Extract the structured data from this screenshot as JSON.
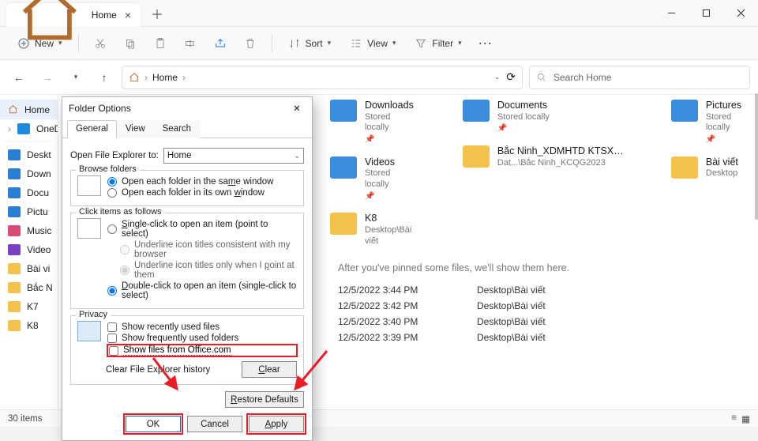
{
  "tab": {
    "title": "Home"
  },
  "toolbar": {
    "new": "New",
    "sort": "Sort",
    "view": "View",
    "filter": "Filter"
  },
  "breadcrumb": {
    "home": "Home"
  },
  "search": {
    "placeholder": "Search Home"
  },
  "sidebar": {
    "items": [
      "Home",
      "OneD",
      "Deskt",
      "Down",
      "Docu",
      "Pictu",
      "Music",
      "Video",
      "Bài vi",
      "Bắc N",
      "K7",
      "K8"
    ]
  },
  "folders": {
    "col1": [
      {
        "name": "Downloads",
        "sub": "Stored locally"
      },
      {
        "name": "Videos",
        "sub": "Stored locally"
      },
      {
        "name": "K8",
        "sub": "Desktop\\Bài viết"
      }
    ],
    "col2": [
      {
        "name": "Documents",
        "sub": "Stored locally"
      },
      {
        "name": "Bắc Ninh_XDMHTD KTSX ...",
        "sub": "Dat...\\Bắc Ninh_KCQG2023"
      }
    ],
    "col3": [
      {
        "name": "Pictures",
        "sub": "Stored locally"
      },
      {
        "name": "Bài viết",
        "sub": "Desktop"
      }
    ]
  },
  "hint": "After you've pinned some files, we'll show them here.",
  "recent": [
    {
      "t": "12/5/2022 3:44 PM",
      "p": "Desktop\\Bài viết"
    },
    {
      "t": "12/5/2022 3:42 PM",
      "p": "Desktop\\Bài viết"
    },
    {
      "t": "12/5/2022 3:40 PM",
      "p": "Desktop\\Bài viết"
    },
    {
      "t": "12/5/2022 3:39 PM",
      "p": "Desktop\\Bài viết"
    }
  ],
  "status": {
    "count": "30 items"
  },
  "dialog": {
    "title": "Folder Options",
    "tabs": {
      "general": "General",
      "view": "View",
      "search": "Search"
    },
    "openLabel": "Open File Explorer to:",
    "openValue": "Home",
    "grp_browse": "Browse folders",
    "r_same": "Open each folder in the same window",
    "r_own": "Open each folder in its own window",
    "grp_click": "Click items as follows",
    "r_single": "Single-click to open an item (point to select)",
    "r_ul1": "Underline icon titles consistent with my browser",
    "r_ul2": "Underline icon titles only when I point at them",
    "r_double": "Double-click to open an item (single-click to select)",
    "grp_privacy": "Privacy",
    "c_recent": "Show recently used files",
    "c_freq": "Show frequently used folders",
    "c_office": "Show files from Office.com",
    "clear_label": "Clear File Explorer history",
    "clear_btn": "Clear",
    "restore": "Restore Defaults",
    "ok": "OK",
    "cancel": "Cancel",
    "apply": "Apply"
  }
}
